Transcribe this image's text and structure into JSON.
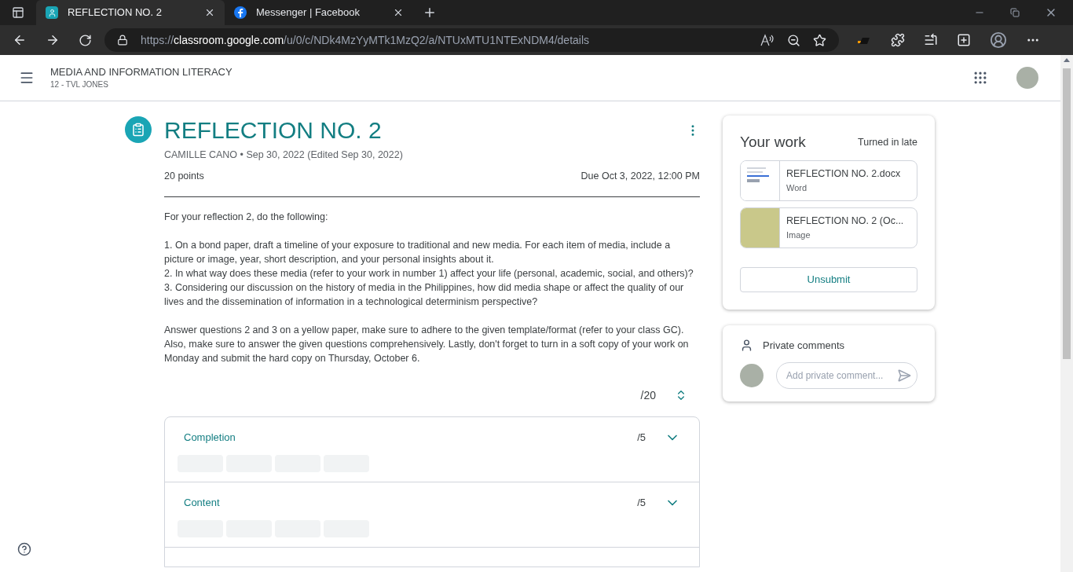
{
  "browser": {
    "tabs": [
      {
        "title": "REFLECTION NO. 2",
        "kind": "classroom",
        "selected": true
      },
      {
        "title": "Messenger | Facebook",
        "kind": "facebook",
        "selected": false
      }
    ],
    "url": {
      "scheme": "https://",
      "host": "classroom.google.com",
      "path": "/u/0/c/NDk4MzYyMTk1MzQ2/a/NTUxMTU1NTExNDM4/details"
    }
  },
  "header": {
    "course": "MEDIA AND INFORMATION LITERACY",
    "section": "12 - TVL JONES"
  },
  "assignment": {
    "title": "REFLECTION NO. 2",
    "meta": "CAMILLE CANO • Sep 30, 2022 (Edited Sep 30, 2022)",
    "points": "20 points",
    "due": "Due Oct 3, 2022, 12:00 PM",
    "paragraphs": [
      [
        "For your reflection 2, do the following:"
      ],
      [
        "1.  On a bond paper, draft a timeline of your exposure to traditional and new media. For each item of media, include a picture or image, year, short description, and your personal insights about it.",
        "2. In what way does these media (refer to your work in number 1) affect your life (personal, academic, social, and others)?",
        "3. Considering our discussion on the history of media in the Philippines, how did media shape or affect the quality of our lives and the dissemination of information in a technological determinism perspective?"
      ],
      [
        "Answer questions 2 and 3 on a yellow paper, make sure to adhere to the given template/format (refer to your class GC). Also, make sure to answer the given questions comprehensively. Lastly, don't forget to turn in a soft copy of your work on Monday and submit the hard copy on Thursday, October 6."
      ]
    ],
    "total": "/20",
    "criteria": [
      {
        "name": "Completion",
        "score": "/5",
        "expanded": false
      },
      {
        "name": "Content",
        "score": "/5",
        "expanded": false
      }
    ]
  },
  "your_work": {
    "title": "Your work",
    "status": "Turned in late",
    "attachments": [
      {
        "name": "REFLECTION NO. 2.docx",
        "type": "Word",
        "kind": "document"
      },
      {
        "name": "REFLECTION NO. 2 (Oc...",
        "type": "Image",
        "kind": "image"
      }
    ],
    "button": "Unsubmit"
  },
  "private_comments": {
    "title": "Private comments",
    "placeholder": "Add private comment..."
  }
}
